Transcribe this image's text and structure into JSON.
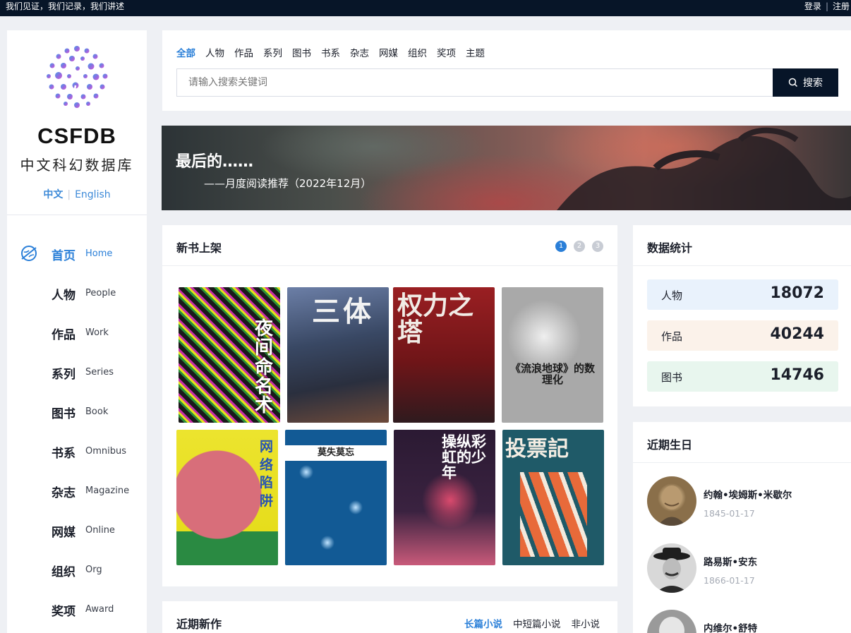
{
  "topbar": {
    "slogan": "我们见证，我们记录，我们讲述",
    "login": "登录",
    "sep": "|",
    "register": "注册"
  },
  "sidebar": {
    "brand": "CSFDB",
    "brand_sub": "中文科幻数据库",
    "lang": {
      "zh": "中文",
      "sep": "|",
      "en": "English"
    },
    "nav": [
      {
        "zh": "首页",
        "en": "Home"
      },
      {
        "zh": "人物",
        "en": "People"
      },
      {
        "zh": "作品",
        "en": "Work"
      },
      {
        "zh": "系列",
        "en": "Series"
      },
      {
        "zh": "图书",
        "en": "Book"
      },
      {
        "zh": "书系",
        "en": "Omnibus"
      },
      {
        "zh": "杂志",
        "en": "Magazine"
      },
      {
        "zh": "网媒",
        "en": "Online"
      },
      {
        "zh": "组织",
        "en": "Org"
      },
      {
        "zh": "奖项",
        "en": "Award"
      }
    ]
  },
  "search": {
    "tabs": [
      "全部",
      "人物",
      "作品",
      "系列",
      "图书",
      "书系",
      "杂志",
      "网媒",
      "组织",
      "奖项",
      "主题"
    ],
    "placeholder": "请输入搜索关键词",
    "button": "搜索"
  },
  "banner": {
    "title": "最后的……",
    "subtitle": "——月度阅读推荐（2022年12月）"
  },
  "new_books": {
    "title": "新书上架",
    "pages": [
      "1",
      "2",
      "3"
    ],
    "books": [
      {
        "title": "夜间命名术",
        "color": "#1a1a1a"
      },
      {
        "title": "三体",
        "color": "#3a4a6a"
      },
      {
        "title": "权力之塔",
        "color": "#8a1c1c"
      },
      {
        "title": "《流浪地球》的数理化",
        "color": "#c9c9c9"
      },
      {
        "title": "网络陷阱",
        "color": "#e6e02a"
      },
      {
        "title": "莫失莫忘",
        "color": "#125a95"
      },
      {
        "title": "操纵彩虹的少年",
        "color": "#2b1a33"
      },
      {
        "title": "投票記",
        "color": "#1f5a68"
      }
    ]
  },
  "recent_works": {
    "title": "近期新作",
    "tabs": [
      "长篇小说",
      "中短篇小说",
      "非小说"
    ]
  },
  "stats": {
    "title": "数据统计",
    "items": [
      {
        "label": "人物",
        "value": "18072",
        "bg": "#e9f2fc"
      },
      {
        "label": "作品",
        "value": "40244",
        "bg": "#fbf2ea"
      },
      {
        "label": "图书",
        "value": "14746",
        "bg": "#e8f6ee"
      }
    ]
  },
  "birthdays": {
    "title": "近期生日",
    "people": [
      {
        "name": "约翰•埃姆斯•米歇尔",
        "date": "1845-01-17"
      },
      {
        "name": "路易斯•安东",
        "date": "1866-01-17"
      },
      {
        "name": "内维尔•舒特",
        "date": ""
      }
    ]
  }
}
